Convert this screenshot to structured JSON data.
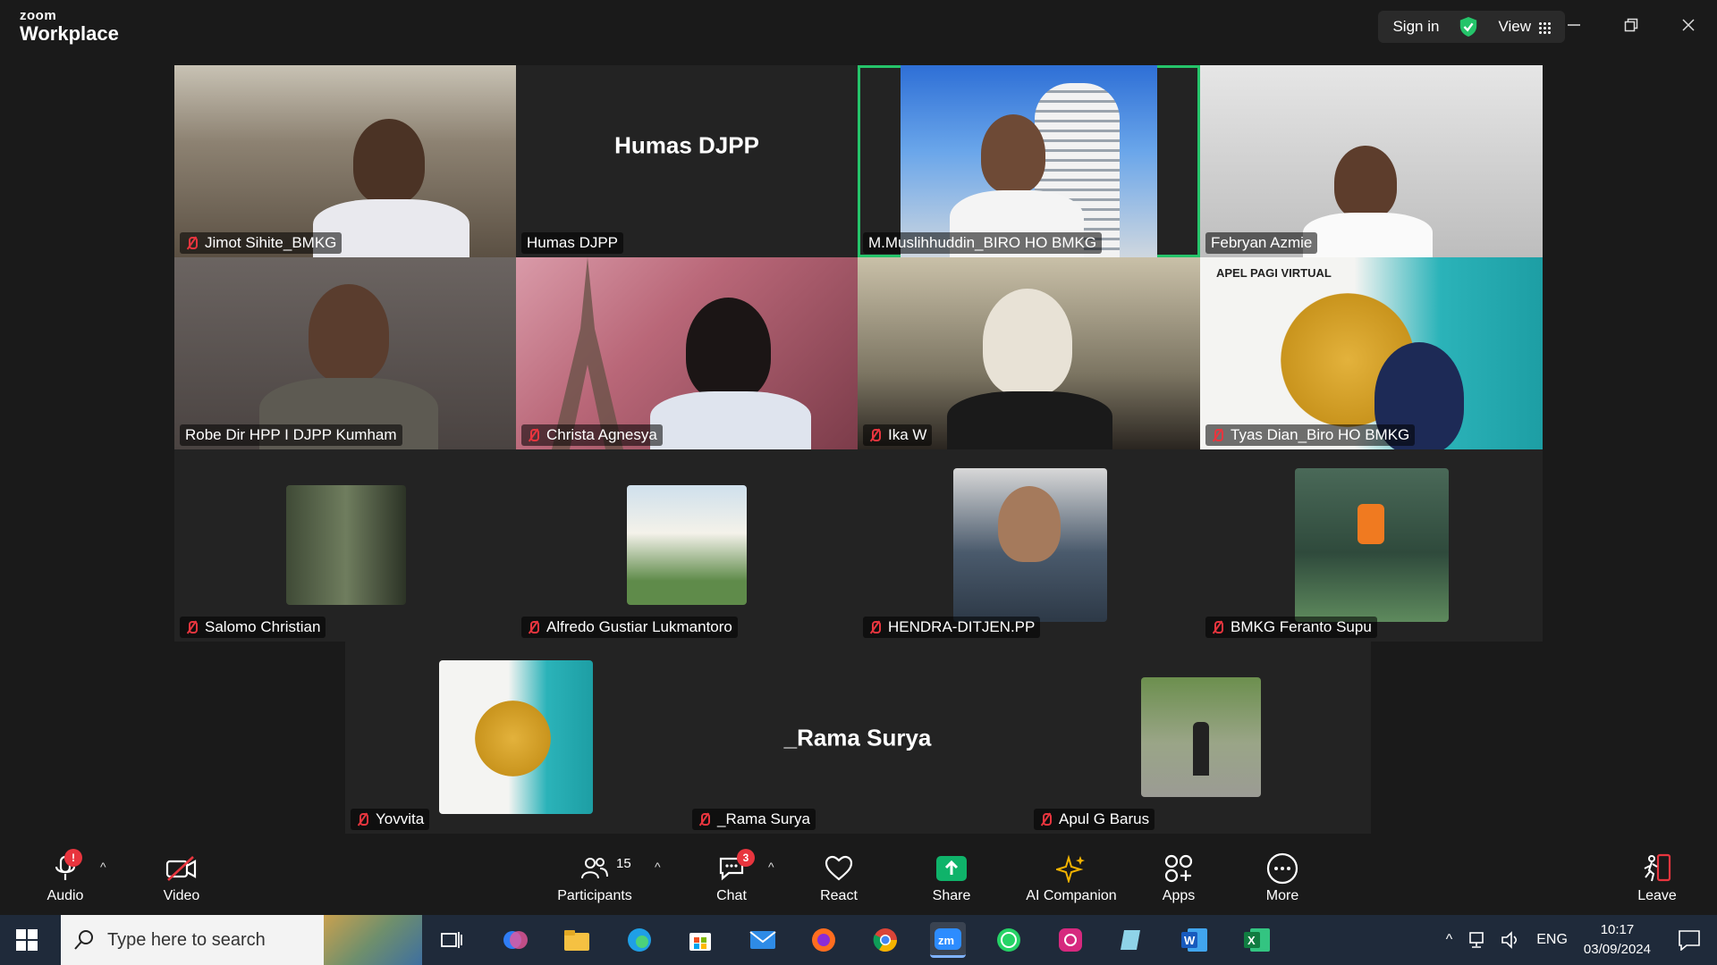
{
  "app": {
    "brand_small": "zoom",
    "brand_big": "Workplace",
    "sign_in": "Sign in",
    "view": "View"
  },
  "participants": [
    {
      "name": "Jimot Sihite_BMKG",
      "muted": true
    },
    {
      "name": "Humas DJPP",
      "muted": false,
      "display_name": "Humas DJPP"
    },
    {
      "name": "M.Muslihhuddin_BIRO HO BMKG",
      "muted": false,
      "active_speaker": true
    },
    {
      "name": "Febryan Azmie",
      "muted": false
    },
    {
      "name": "Robe Dir HPP I DJPP Kumham",
      "muted": false
    },
    {
      "name": "Christa Agnesya",
      "muted": true
    },
    {
      "name": "Ika W",
      "muted": true
    },
    {
      "name": "Tyas Dian_Biro HO BMKG",
      "muted": true,
      "video_overlay": "APEL PAGI VIRTUAL"
    },
    {
      "name": "Salomo Christian",
      "muted": true
    },
    {
      "name": "Alfredo Gustiar Lukmantoro",
      "muted": true
    },
    {
      "name": "HENDRA-DITJEN.PP",
      "muted": true
    },
    {
      "name": "BMKG Feranto Supu",
      "muted": true
    },
    {
      "name": "Yovvita",
      "muted": true
    },
    {
      "name": "_Rama Surya",
      "muted": true,
      "display_name": "_Rama Surya"
    },
    {
      "name": "Apul G Barus",
      "muted": true
    }
  ],
  "toolbar": {
    "audio": "Audio",
    "audio_badge": "!",
    "video": "Video",
    "participants": "Participants",
    "participants_count": "15",
    "chat": "Chat",
    "chat_badge": "3",
    "react": "React",
    "share": "Share",
    "ai": "AI Companion",
    "apps": "Apps",
    "more": "More",
    "leave": "Leave"
  },
  "taskbar": {
    "search_placeholder": "Type here to search",
    "lang": "ENG",
    "time": "10:17",
    "date": "03/09/2024"
  },
  "colors": {
    "active_speaker": "#25c46a",
    "muted": "#e8353e",
    "share": "#0fb36a",
    "leave": "#e8353e"
  }
}
